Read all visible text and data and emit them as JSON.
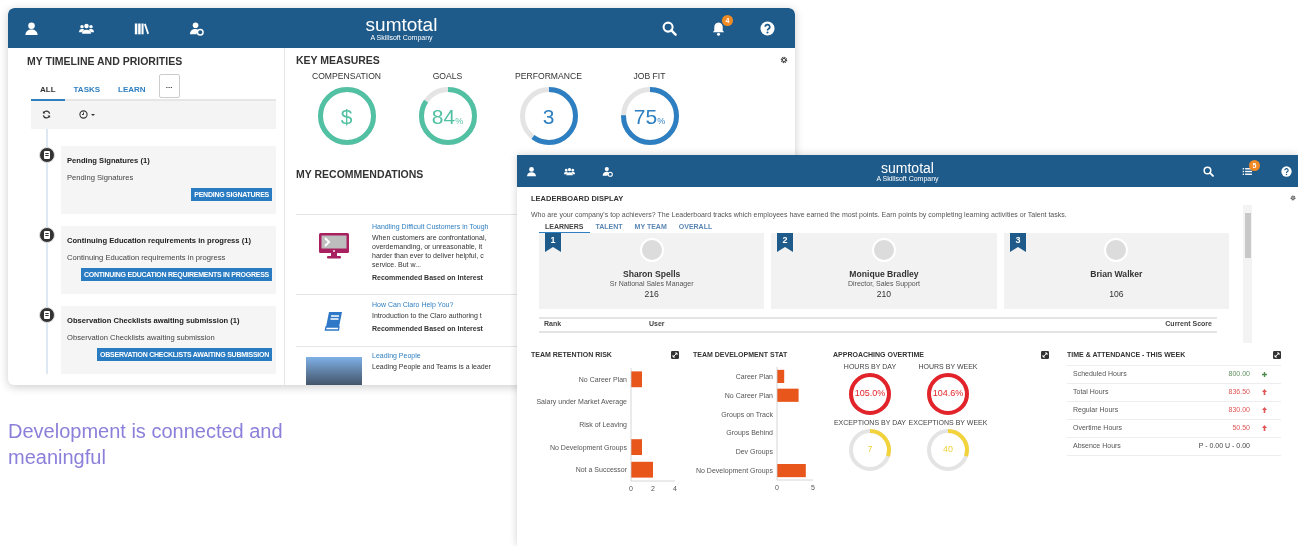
{
  "back_window": {
    "header": {
      "logo": "sumtotal",
      "logo_tagline": "A Skillsoft Company",
      "notification_count": "4"
    },
    "timeline": {
      "title": "MY TIMELINE AND PRIORITIES",
      "tabs": [
        {
          "label": "ALL",
          "selected": true
        },
        {
          "label": "TASKS",
          "selected": false
        },
        {
          "label": "LEARN",
          "selected": false
        }
      ],
      "more_button": "...",
      "items": [
        {
          "title": "Pending Signatures (1)",
          "subtitle": "Pending Signatures",
          "button": "PENDING SIGNATURES"
        },
        {
          "title": "Continuing Education requirements in progress (1)",
          "subtitle": "Continuing Education requirements in progress",
          "button": "CONTINUING EDUCATION REQUIREMENTS IN PROGRESS"
        },
        {
          "title": "Observation Checklists awaiting submission (1)",
          "subtitle": "Observation Checklists awaiting submission",
          "button": "OBSERVATION CHECKLISTS AWAITING SUBMISSION"
        }
      ]
    },
    "key_measures": {
      "title": "KEY MEASURES",
      "gauges": [
        {
          "label": "COMPENSATION",
          "value": "$",
          "level": 1,
          "color": "#52c1a3"
        },
        {
          "label": "GOALS",
          "value": "84",
          "unit": "%",
          "level": 0.84,
          "color": "#52c1a3"
        },
        {
          "label": "PERFORMANCE",
          "value": "3",
          "level": 0.6,
          "color": "#2d7fc1"
        },
        {
          "label": "JOB FIT",
          "value": "75",
          "unit": "%",
          "level": 0.75,
          "color": "#2d7fc1"
        }
      ]
    },
    "recommendations": {
      "title": "MY RECOMMENDATIONS",
      "items": [
        {
          "kind": "course",
          "title": "Handling Difficult Customers in Tough",
          "description_lines": [
            "When customers are confrontational,",
            "overdemanding, or unreasonable, it",
            "harder than ever to deliver helpful, c",
            "service. But w..."
          ],
          "reason": "Recommended Based on Interest"
        },
        {
          "kind": "book",
          "title": "How Can Claro Help You?",
          "description_lines": [
            "Introduction to the Claro authoring t"
          ],
          "reason": "Recommended Based on Interest"
        },
        {
          "kind": "photo",
          "title": "Leading People",
          "description_lines": [
            "Leading People and Teams is a leader"
          ]
        }
      ]
    }
  },
  "front_window": {
    "header": {
      "logo": "sumtotal",
      "logo_tagline": "A Skillsoft Company",
      "notification_count": "5"
    },
    "leaderboard": {
      "title": "LEADERBOARD DISPLAY",
      "description": "Who are your company's top achievers? The Leaderboard tracks which employees have earned the most points. Earn points by completing learning activities or Talent tasks.",
      "tabs": [
        {
          "label": "LEARNERS",
          "selected": true
        },
        {
          "label": "TALENT",
          "selected": false
        },
        {
          "label": "MY TEAM",
          "selected": false
        },
        {
          "label": "OVERALL",
          "selected": false
        }
      ],
      "leaders": [
        {
          "rank": "1",
          "name": "Sharon Spells",
          "role": "Sr National Sales Manager",
          "score": "216"
        },
        {
          "rank": "2",
          "name": "Monique Bradley",
          "role": "Director, Sales Support",
          "score": "210"
        },
        {
          "rank": "3",
          "name": "Brian Walker",
          "score": "106"
        }
      ],
      "columns": [
        "Rank",
        "User",
        "Current Score"
      ]
    },
    "team_retention_risk": {
      "title": "TEAM RETENTION RISK",
      "chart_data": {
        "type": "bar",
        "orientation": "horizontal",
        "categories": [
          "No Career Plan",
          "Salary under Market Average",
          "Risk of Leaving",
          "No Development Groups",
          "Not a Successor"
        ],
        "values": [
          1,
          0,
          0,
          1,
          2
        ],
        "xlim": [
          0,
          4
        ],
        "xticks": [
          0,
          2,
          4
        ]
      }
    },
    "team_development_status": {
      "title": "TEAM DEVELOPMENT STAT",
      "chart_data": {
        "type": "bar",
        "orientation": "horizontal",
        "categories": [
          "Career Plan",
          "No Career Plan",
          "Groups on Track",
          "Groups Behind",
          "Dev Groups",
          "No Development Groups"
        ],
        "values": [
          1,
          3,
          0,
          0,
          0,
          4
        ],
        "xlim": [
          0,
          5
        ],
        "xticks": [
          0,
          5
        ]
      }
    },
    "approaching_overtime": {
      "title": "APPROACHING OVERTIME",
      "gauges": [
        {
          "label": "HOURS BY DAY",
          "value": "105.0%",
          "level": 1,
          "color": "#e2232a"
        },
        {
          "label": "HOURS BY WEEK",
          "value": "104.6%",
          "level": 1,
          "color": "#e2232a"
        },
        {
          "label": "EXCEPTIONS BY DAY",
          "value": "7",
          "level": 0.3,
          "color": "#f2d33c"
        },
        {
          "label": "EXCEPTIONS BY WEEK",
          "value": "40",
          "level": 0.3,
          "color": "#f2d33c"
        }
      ]
    },
    "time_attendance": {
      "title": "TIME & ATTENDANCE - THIS WEEK",
      "rows": [
        {
          "label": "Scheduled Hours",
          "value": "800.00",
          "kind": "ok"
        },
        {
          "label": "Total Hours",
          "value": "836.50",
          "kind": "over"
        },
        {
          "label": "Regular Hours",
          "value": "830.00",
          "kind": "over"
        },
        {
          "label": "Overtime Hours",
          "value": "50.50",
          "kind": "over"
        },
        {
          "label": "Absence Hours",
          "value": "P - 0.00 U - 0.00",
          "kind": "none"
        }
      ]
    }
  },
  "caption": "Development is connected and meaningful"
}
